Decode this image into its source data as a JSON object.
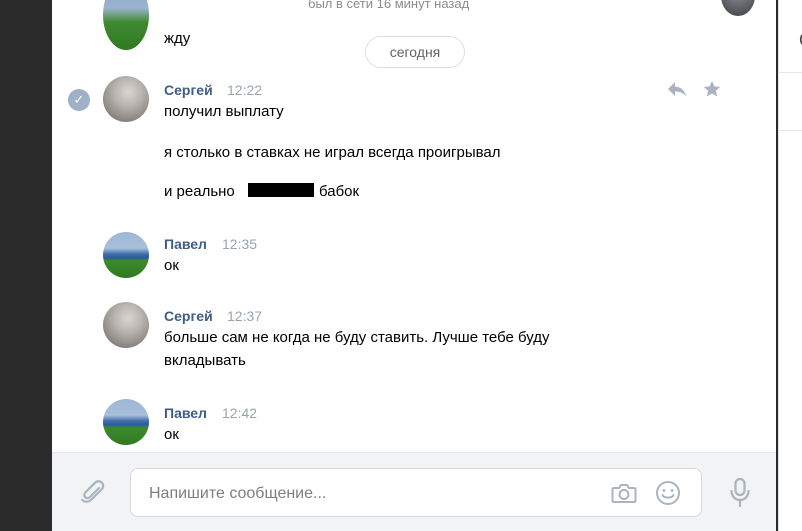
{
  "header": {
    "status_text": "был в сети 16 минут назад"
  },
  "prev_message": {
    "text": "жду"
  },
  "date_separator": "сегодня",
  "messages": [
    {
      "author": "Сергей",
      "time": "12:22",
      "lines": [
        "получил выплату",
        "я столько в ставках не играл всегда проигрывал",
        "и реально",
        "бабок"
      ]
    },
    {
      "author": "Павел",
      "time": "12:35",
      "lines": [
        "ок"
      ]
    },
    {
      "author": "Сергей",
      "time": "12:37",
      "lines": [
        "больше сам не когда не буду ставить. Лучше тебе буду",
        "вкладывать"
      ]
    },
    {
      "author": "Павел",
      "time": "12:42",
      "lines": [
        "ок"
      ]
    }
  ],
  "composer": {
    "placeholder": "Напишите сообщение..."
  },
  "icons": {
    "check": "check-icon",
    "reply": "reply-icon",
    "star": "star-icon",
    "attach": "paperclip-icon",
    "camera": "camera-icon",
    "emoji": "emoji-icon",
    "mic": "microphone-icon"
  },
  "colors": {
    "name": "#3f5e85",
    "time": "#9aa3ad",
    "accent_icon": "#aab4c0"
  }
}
